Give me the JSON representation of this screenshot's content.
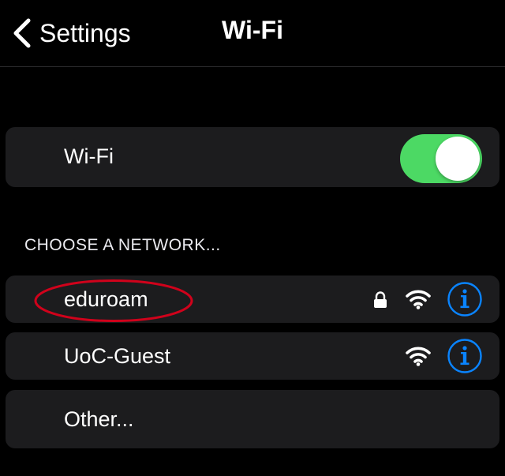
{
  "navbar": {
    "back_label": "Settings",
    "title": "Wi-Fi"
  },
  "wifi_toggle": {
    "label": "Wi-Fi",
    "state": "on"
  },
  "section_header": "CHOOSE A NETWORK...",
  "networks": [
    {
      "name": "eduroam",
      "secured": true,
      "icons": [
        "lock-icon",
        "wifi-icon",
        "info-icon"
      ]
    },
    {
      "name": "UoC-Guest",
      "secured": false,
      "icons": [
        "wifi-icon",
        "info-icon"
      ]
    }
  ],
  "other_label": "Other...",
  "colors": {
    "background": "#000000",
    "cell": "#1c1c1e",
    "toggle_on": "#4cd964",
    "accent_blue": "#0a84ff",
    "annotation_red": "#d0021b"
  }
}
